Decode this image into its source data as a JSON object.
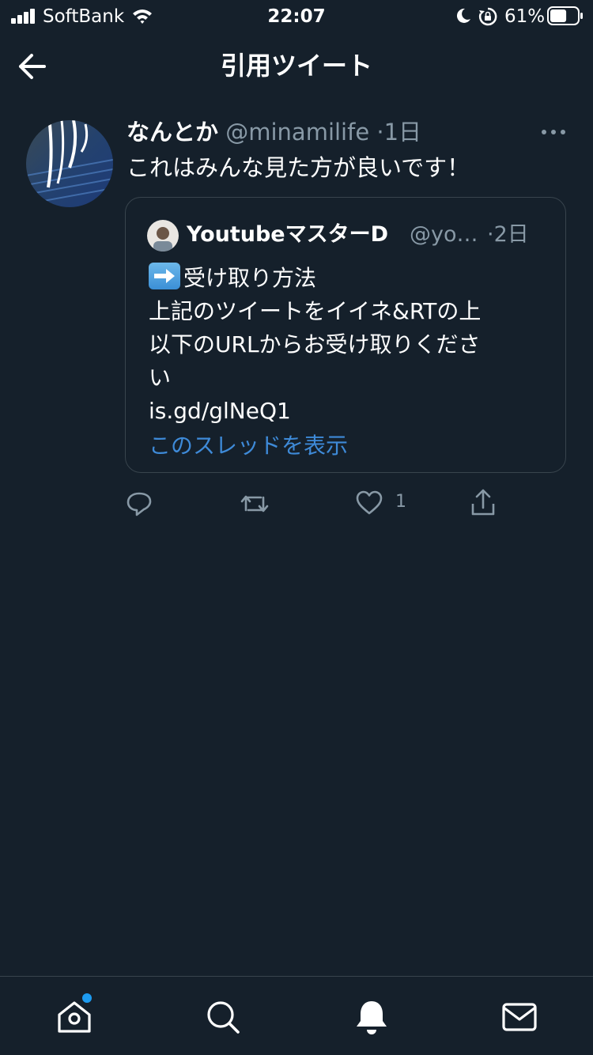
{
  "status_bar": {
    "carrier": "SoftBank",
    "time": "22:07",
    "battery_percent": "61%",
    "battery_level": 0.61,
    "icons": [
      "signal-icon",
      "wifi-icon",
      "moon-icon",
      "rotation-lock-icon",
      "battery-icon"
    ]
  },
  "header": {
    "title": "引用ツイート",
    "back_icon": "back-arrow-icon"
  },
  "tweet": {
    "author_name": "なんとか",
    "author_handle": "@minamilife",
    "separator": "·",
    "time": "1日",
    "text": "これはみんな見た方が良いです！",
    "more_icon": "more-horizontal-icon",
    "quote": {
      "author_name": "YoutubeマスターD",
      "author_handle": "@yo…",
      "separator": "·",
      "time": "2日",
      "emoji": "right-arrow-emoji",
      "lines": [
        "受け取り方法",
        "上記のツイートをイイネ&RTの上",
        "以下のURLからお受け取りくださ",
        "い",
        "is.gd/glNeQ1"
      ],
      "show_thread": "このスレッドを表示"
    },
    "actions": {
      "reply_icon": "reply-icon",
      "retweet_icon": "retweet-icon",
      "like_icon": "heart-icon",
      "like_count": "1",
      "share_icon": "share-icon"
    }
  },
  "tab_bar": {
    "items": [
      {
        "icon": "home-icon",
        "has_badge": true
      },
      {
        "icon": "search-icon"
      },
      {
        "icon": "bell-icon"
      },
      {
        "icon": "mail-icon"
      }
    ]
  },
  "colors": {
    "background": "#15202b",
    "text_primary": "#ffffff",
    "text_secondary": "#8899a6",
    "border": "#38444d",
    "link": "#3e8ad8",
    "badge": "#1d9bf0"
  }
}
